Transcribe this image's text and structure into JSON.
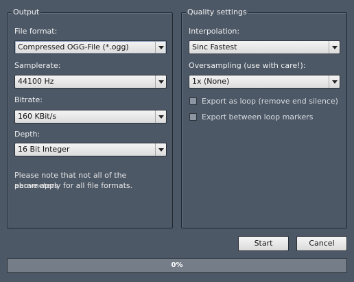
{
  "output": {
    "title": "Output",
    "file_format_label": "File format:",
    "file_format_value": "Compressed OGG-File (*.ogg)",
    "samplerate_label": "Samplerate:",
    "samplerate_value": "44100 Hz",
    "bitrate_label": "Bitrate:",
    "bitrate_value": "160 KBit/s",
    "depth_label": "Depth:",
    "depth_value": "16 Bit Integer",
    "note_line1": "Please note that not all of the parameters",
    "note_line2": "above apply for all file formats."
  },
  "quality": {
    "title": "Quality settings",
    "interpolation_label": "Interpolation:",
    "interpolation_value": "Sinc Fastest",
    "oversampling_label": "Oversampling (use with care!):",
    "oversampling_value": "1x (None)",
    "export_loop_label": "Export as loop (remove end silence)",
    "export_loop_checked": false,
    "export_markers_label": "Export between loop markers",
    "export_markers_checked": false
  },
  "actions": {
    "start_label": "Start",
    "cancel_label": "Cancel"
  },
  "progress": {
    "text": "0%",
    "value": 0
  },
  "icons": {
    "dropdown": "chevron-down-icon"
  }
}
